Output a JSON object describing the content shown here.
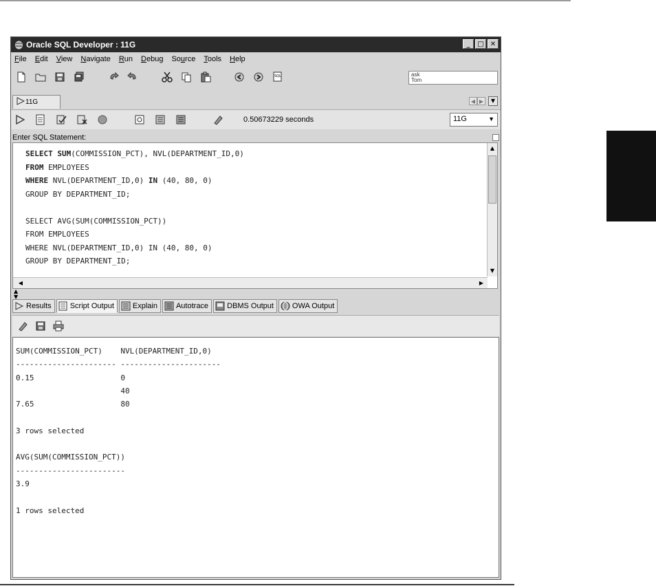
{
  "window": {
    "title": "Oracle SQL Developer : 11G"
  },
  "menu": {
    "file": "F",
    "file_rest": "ile",
    "edit": "E",
    "edit_rest": "dit",
    "view": "V",
    "view_rest": "iew",
    "navigate": "N",
    "navigate_rest": "avigate",
    "run": "R",
    "run_rest": "un",
    "debug": "D",
    "debug_rest": "ebug",
    "source_pre": "So",
    "source_u": "u",
    "source_rest": "rce",
    "tools": "T",
    "tools_rest": "ools",
    "help": "H",
    "help_rest": "elp"
  },
  "search": {
    "line1": "ask",
    "line2": "Tom"
  },
  "document_tab": {
    "label": "11G"
  },
  "worksheet": {
    "exec_time": "0.50673229 seconds",
    "connection": "11G",
    "sql_label": "Enter SQL Statement:"
  },
  "sql": {
    "l1_kw1": "SELECT",
    "l1_kw2": "SUM",
    "l1_rest": "(COMMISSION_PCT), NVL(DEPARTMENT_ID,0)",
    "l2_kw": "FROM",
    "l2_rest": " EMPLOYEES",
    "l3_kw": "WHERE",
    "l3_mid": " NVL(DEPARTMENT_ID,0) ",
    "l3_kw2": "IN",
    "l3_rest": " (40, 80, 0)",
    "l4": "GROUP BY DEPARTMENT_ID;",
    "l5": "",
    "l6": "SELECT AVG(SUM(COMMISSION_PCT))",
    "l7": "FROM EMPLOYEES",
    "l8": "WHERE NVL(DEPARTMENT_ID,0) IN (40, 80, 0)",
    "l9": "GROUP BY DEPARTMENT_ID;"
  },
  "result_tabs": [
    "Results",
    "Script Output",
    "Explain",
    "Autotrace",
    "DBMS Output",
    "OWA Output"
  ],
  "output": {
    "header1": "SUM(COMMISSION_PCT)    NVL(DEPARTMENT_ID,0)",
    "rule1": "---------------------- ----------------------",
    "row1": "0.15                   0",
    "row2": "                       40",
    "row3": "7.65                   80",
    "blank1": "",
    "summary1": "3 rows selected",
    "blank2": "",
    "header2": "AVG(SUM(COMMISSION_PCT))",
    "rule2": "------------------------",
    "row4": "3.9",
    "blank3": "",
    "summary2": "1 rows selected"
  }
}
